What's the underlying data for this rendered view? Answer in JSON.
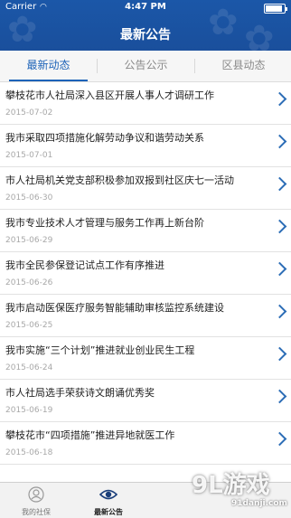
{
  "status": {
    "carrier": "Carrier",
    "time": "4:47 PM"
  },
  "nav": {
    "title": "最新公告"
  },
  "tabs": [
    {
      "label": "最新动态",
      "active": true
    },
    {
      "label": "公告公示",
      "active": false
    },
    {
      "label": "区县动态",
      "active": false
    }
  ],
  "items": [
    {
      "title": "攀枝花市人社局深入县区开展人事人才调研工作",
      "date": "2015-07-02"
    },
    {
      "title": "我市采取四项措施化解劳动争议和谐劳动关系",
      "date": "2015-07-01"
    },
    {
      "title": "市人社局机关党支部积极参加双报到社区庆七一活动",
      "date": "2015-06-30"
    },
    {
      "title": "我市专业技术人才管理与服务工作再上新台阶",
      "date": "2015-06-29"
    },
    {
      "title": "我市全民参保登记试点工作有序推进",
      "date": "2015-06-26"
    },
    {
      "title": "我市启动医保医疗服务智能辅助审核监控系统建设",
      "date": "2015-06-25"
    },
    {
      "title": "我市实施“三个计划”推进就业创业民生工程",
      "date": "2015-06-24"
    },
    {
      "title": "市人社局选手荣获诗文朗诵优秀奖",
      "date": "2015-06-19"
    },
    {
      "title": "攀枝花市“四项措施”推进异地就医工作",
      "date": "2015-06-18"
    }
  ],
  "tabbar": [
    {
      "label": "我的社保",
      "icon": "person-icon",
      "active": false
    },
    {
      "label": "最新公告",
      "icon": "eye-icon",
      "active": true
    }
  ],
  "watermark": {
    "brand": "9L游戏",
    "site": "91danji.com"
  },
  "colors": {
    "header": "#1b57a8",
    "accent": "#1d63b8"
  }
}
